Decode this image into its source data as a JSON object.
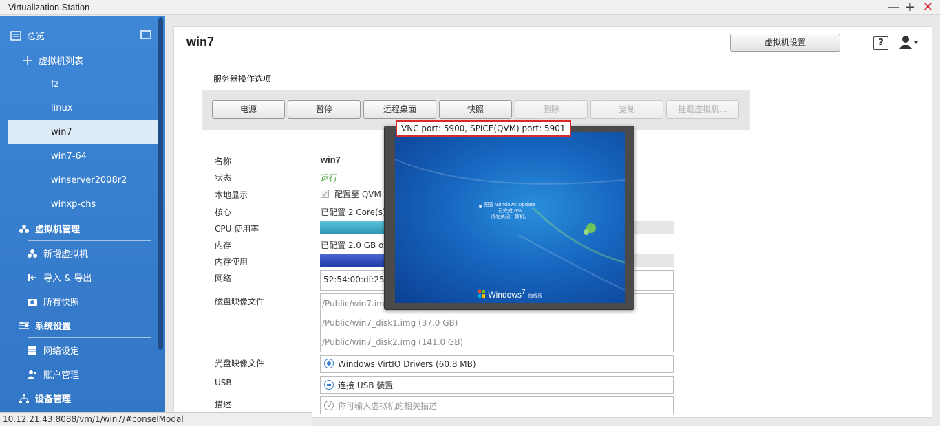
{
  "window": {
    "title": "Virtualization Station",
    "minimize": "—",
    "maximize": "+",
    "close": "✕"
  },
  "sidebar": {
    "overview": "总览",
    "vm_list": "虚拟机列表",
    "vms": [
      "fz",
      "linux",
      "win7",
      "win7-64",
      "winserver2008r2",
      "winxp-chs"
    ],
    "active_vm": "win7",
    "vm_management": "虚拟机管理",
    "add_vm": "新增虚拟机",
    "import_export": "导入 & 导出",
    "all_snapshots": "所有快照",
    "system_settings": "系统设置",
    "network_settings": "网络设定",
    "account_management": "账户管理",
    "device_management": "设备管理"
  },
  "header": {
    "vm_name": "win7",
    "vm_settings": "虚拟机设置",
    "help": "?"
  },
  "server_ops": {
    "title": "服务器操作选项",
    "buttons": [
      {
        "label": "电源",
        "enabled": true
      },
      {
        "label": "暂停",
        "enabled": true
      },
      {
        "label": "远程桌面",
        "enabled": true
      },
      {
        "label": "快照",
        "enabled": true
      },
      {
        "label": "删除",
        "enabled": false
      },
      {
        "label": "复制",
        "enabled": false
      },
      {
        "label": "挂载虚拟机...",
        "enabled": false
      }
    ]
  },
  "details": {
    "name_label": "名称",
    "name_value": "win7",
    "status_label": "状态",
    "status_value": "运行",
    "local_display_label": "本地显示",
    "local_display_value": "配置至 QVM",
    "cores_label": "核心",
    "cores_value": "已配置 2 Core(s)",
    "cpu_label": "CPU 使用率",
    "cpu_usage_fraction": 0.18,
    "memory_label": "内存",
    "memory_value": "已配置 2.0 GB of",
    "memory_usage_label": "内存使用",
    "memory_usage_fraction": 0.18,
    "network_label": "网络",
    "network_value": "52:54:00:df:25",
    "disk_label": "磁盘映像文件",
    "disks": [
      "/Public/win7.img",
      "/Public/win7_disk1.img (37.0 GB)",
      "/Public/win7_disk2.img (141.0 GB)"
    ],
    "cd_label": "光盘映像文件",
    "cd_value": "Windows VirtIO Drivers (60.8 MB)",
    "usb_label": "USB",
    "usb_value": "连接 USB 装置",
    "desc_label": "描述",
    "desc_placeholder": "你可输入虚拟机的相关描述"
  },
  "vnc_preview": {
    "tooltip": "VNC port: 5900, SPICE(QVM) port: 5901",
    "update_line1": "配置 Windows Update",
    "update_line2": "已完成 0%",
    "update_line3": "请勿关闭计算机。",
    "logo_text": "Windows",
    "logo_version": "7",
    "edition": "旗舰版"
  },
  "status_url": "10.12.21.43:8088/vm/1/win7/#conselModal",
  "colors": {
    "sidebar": "#3b82d1",
    "accent_green": "#3d9b2f",
    "highlight_red": "#d9292a"
  }
}
